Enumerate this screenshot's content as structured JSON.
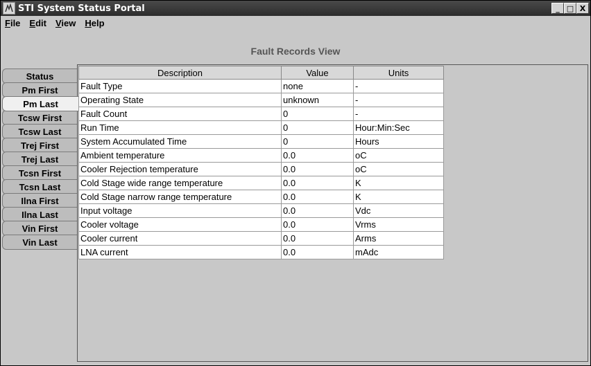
{
  "window": {
    "title": "STI System Status Portal",
    "controls": [
      "_",
      "□",
      "X"
    ]
  },
  "menu": [
    "File",
    "Edit",
    "View",
    "Help"
  ],
  "view_title": "Fault Records View",
  "tabs": [
    "Status",
    "Pm First",
    "Pm Last",
    "Tcsw First",
    "Tcsw Last",
    "Trej First",
    "Trej Last",
    "Tcsn First",
    "Tcsn Last",
    "Ilna First",
    "Ilna Last",
    "Vin First",
    "Vin Last"
  ],
  "active_tab": "Pm Last",
  "table": {
    "headers": [
      "Description",
      "Value",
      "Units"
    ],
    "rows": [
      [
        "Fault Type",
        "none",
        "-"
      ],
      [
        "Operating State",
        "unknown",
        "-"
      ],
      [
        "Fault Count",
        "0",
        "-"
      ],
      [
        "Run Time",
        "0",
        "Hour:Min:Sec"
      ],
      [
        "System Accumulated Time",
        "0",
        "Hours"
      ],
      [
        "Ambient temperature",
        "0.0",
        "oC"
      ],
      [
        "Cooler Rejection temperature",
        "0.0",
        "oC"
      ],
      [
        "Cold Stage wide range temperature",
        "0.0",
        "K"
      ],
      [
        "Cold Stage narrow range temperature",
        "0.0",
        "K"
      ],
      [
        "Input voltage",
        "0.0",
        "Vdc"
      ],
      [
        "Cooler voltage",
        "0.0",
        "Vrms"
      ],
      [
        "Cooler current",
        "0.0",
        "Arms"
      ],
      [
        "LNA current",
        "0.0",
        "mAdc"
      ]
    ]
  }
}
